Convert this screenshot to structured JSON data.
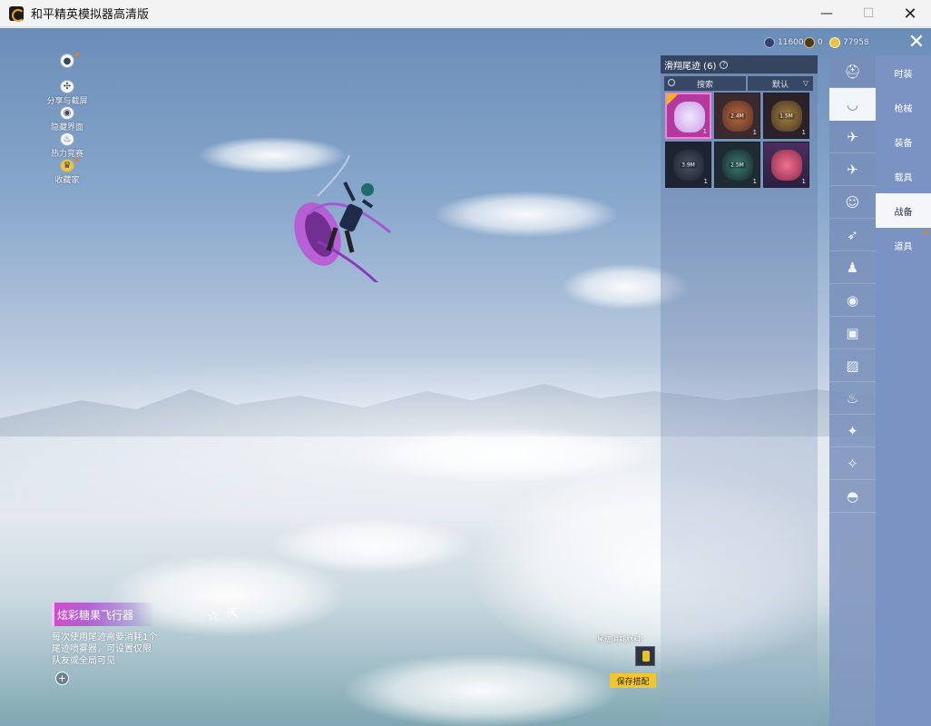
{
  "window": {
    "title": "和平精英模拟器高清版",
    "minimize": "—",
    "maximize": "☐",
    "close": "✕"
  },
  "left_menu": [
    {
      "label": "",
      "icon": "user-icon",
      "dot": true
    },
    {
      "label": "分享与截屏",
      "icon": "share-icon",
      "dot": false
    },
    {
      "label": "隐藏界面",
      "icon": "eye-icon",
      "dot": false
    },
    {
      "label": "热力竞赛",
      "icon": "flame-icon",
      "dot": false
    },
    {
      "label": "收藏家",
      "icon": "crown-icon",
      "dot": true
    }
  ],
  "currency": {
    "gems": "11600",
    "medals": "0",
    "coins": "77958"
  },
  "panel": {
    "title": "滑翔尾迹 (6)",
    "search_placeholder": "搜索",
    "sort_label": "默认",
    "items": [
      {
        "name": "炫彩糖果飞行器",
        "badge": "",
        "count": "1",
        "color": "#b6389e",
        "art": "#e7d6f6",
        "selected": true
      },
      {
        "name": "",
        "badge": "2.4M",
        "count": "1",
        "color": "#3a2a2e",
        "art": "#9a5a3a",
        "selected": false
      },
      {
        "name": "",
        "badge": "1.5M",
        "count": "1",
        "color": "#2a2228",
        "art": "#8a6a3a",
        "selected": false
      },
      {
        "name": "",
        "badge": "3.9M",
        "count": "1",
        "color": "#1d2330",
        "art": "#3a4250",
        "selected": false
      },
      {
        "name": "",
        "badge": "2.5M",
        "count": "1",
        "color": "#1f2a32",
        "art": "#2f5a56",
        "selected": false
      },
      {
        "name": "",
        "badge": "",
        "count": "1",
        "color": "#3b2c56",
        "art": "#d7406a",
        "selected": false
      }
    ]
  },
  "categories": [
    {
      "icon": "helmet-icon",
      "glyph": "⛑",
      "active": false
    },
    {
      "icon": "trail-icon",
      "glyph": "◡",
      "active": true
    },
    {
      "icon": "drone-icon",
      "glyph": "✈",
      "active": false
    },
    {
      "icon": "plane-icon",
      "glyph": "✈",
      "active": false
    },
    {
      "icon": "emoji-icon",
      "glyph": "☺",
      "active": false
    },
    {
      "icon": "flight-icon",
      "glyph": "➶",
      "active": false
    },
    {
      "icon": "robot-icon",
      "glyph": "♟",
      "active": false
    },
    {
      "icon": "sound-icon",
      "glyph": "◉",
      "active": false
    },
    {
      "icon": "card-icon",
      "glyph": "▣",
      "active": false
    },
    {
      "icon": "photo-icon",
      "glyph": "▨",
      "active": false
    },
    {
      "icon": "spray-icon",
      "glyph": "♨",
      "active": false
    },
    {
      "icon": "sparkle-icon",
      "glyph": "✦",
      "active": false
    },
    {
      "icon": "wand-icon",
      "glyph": "✧",
      "active": false
    },
    {
      "icon": "ufo-icon",
      "glyph": "◓",
      "active": false
    }
  ],
  "tabs": [
    {
      "label": "时装",
      "active": false,
      "dot": false
    },
    {
      "label": "枪械",
      "active": false,
      "dot": false
    },
    {
      "label": "装备",
      "active": false,
      "dot": false
    },
    {
      "label": "载具",
      "active": false,
      "dot": false
    },
    {
      "label": "战备",
      "active": true,
      "dot": false
    },
    {
      "label": "道具",
      "active": false,
      "dot": true
    }
  ],
  "item_detail": {
    "name": "炫彩糖果飞行器",
    "description": "每次使用尾迹需要消耗1个尾迹喷雾器，可设置仅限队友或全局可见"
  },
  "material": {
    "label": "尾迹消耗材料：",
    "save_button": "保存搭配"
  },
  "colors": {
    "accent_yellow": "#f3c72a",
    "tab_bg": "#7b93c2",
    "item_name_bg": "#d24bc7"
  }
}
